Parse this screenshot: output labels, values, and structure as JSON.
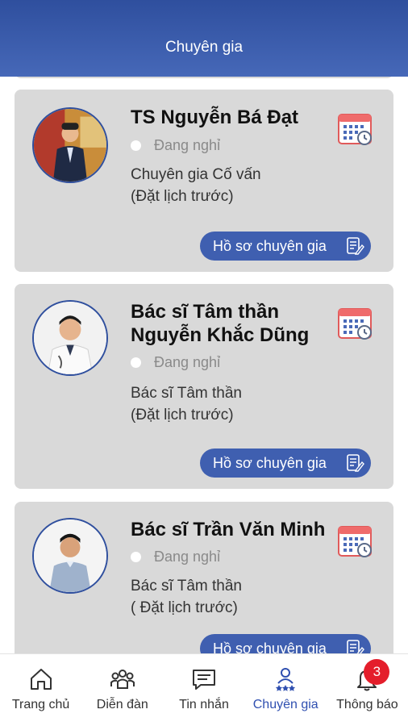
{
  "header": {
    "title": "Chuyên gia"
  },
  "experts": [
    {
      "name": "TS Nguyễn Bá Đạt",
      "status": "Đang nghỉ",
      "role_line1": "Chuyên gia Cố vấn",
      "role_line2": "(Đặt lịch trước)",
      "profile_button": "Hồ sơ chuyên gia"
    },
    {
      "name": "Bác sĩ Tâm thần Nguyễn Khắc Dũng",
      "status": "Đang nghỉ",
      "role_line1": "Bác sĩ Tâm thần",
      "role_line2": "(Đặt lịch trước)",
      "profile_button": "Hồ sơ chuyên gia"
    },
    {
      "name": "Bác sĩ Trần Văn Minh",
      "status": "Đang nghỉ",
      "role_line1": "Bác sĩ Tâm thần",
      "role_line2": "( Đặt lịch trước)",
      "profile_button": "Hồ sơ chuyên gia"
    }
  ],
  "tabs": [
    {
      "label": "Trang chủ",
      "icon": "home-icon"
    },
    {
      "label": "Diễn đàn",
      "icon": "forum-icon"
    },
    {
      "label": "Tin nhắn",
      "icon": "message-icon"
    },
    {
      "label": "Chuyên gia",
      "icon": "experts-icon",
      "active": true
    },
    {
      "label": "Thông báo",
      "icon": "bell-icon",
      "badge": "3"
    }
  ],
  "colors": {
    "primary": "#3f5fb0",
    "header": "#2f4f9e",
    "card": "#d9d9d9",
    "badge": "#e41e2b"
  }
}
